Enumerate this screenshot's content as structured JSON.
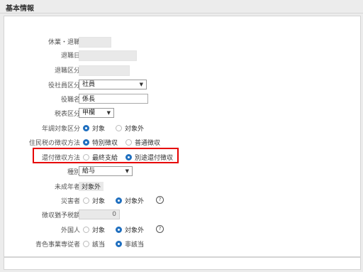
{
  "section": {
    "title": "基本情報"
  },
  "rows": {
    "leave": {
      "label": "休業・退職"
    },
    "retire_date": {
      "label": "退職日"
    },
    "retire_type": {
      "label": "退職区分"
    },
    "employee_type": {
      "label": "役社員区分",
      "value": "社員"
    },
    "position": {
      "label": "役職名",
      "value": "係長"
    },
    "tax_table": {
      "label": "税表区分",
      "value": "甲欄"
    },
    "year_end": {
      "label": "年調対象区分",
      "options": [
        "対象",
        "対象外"
      ],
      "selected": "対象"
    },
    "resident_tax": {
      "label": "住民税の徴収方法",
      "options": [
        "特別徴収",
        "普通徴収"
      ],
      "selected": "特別徴収"
    },
    "refund_method": {
      "label": "還付徴収方法",
      "options": [
        "最終支給",
        "別途還付徴収"
      ],
      "selected": "別途還付徴収"
    },
    "kind": {
      "label": "種別",
      "value": "給与"
    },
    "minor": {
      "label": "未成年者",
      "value": "対象外"
    },
    "disaster": {
      "label": "災害者",
      "options": [
        "対象",
        "対象外"
      ],
      "selected": "対象外",
      "help": "?"
    },
    "deferred_tax": {
      "label": "徴収猶予税額",
      "value": "0"
    },
    "foreigner": {
      "label": "外国人",
      "options": [
        "対象",
        "対象外"
      ],
      "selected": "対象外",
      "help": "?"
    },
    "blue_return": {
      "label": "青色事業専従者",
      "options": [
        "該当",
        "非該当"
      ],
      "selected": "非該当"
    }
  },
  "colors": {
    "accent": "#1f6fbf",
    "highlight": "#e60000"
  }
}
